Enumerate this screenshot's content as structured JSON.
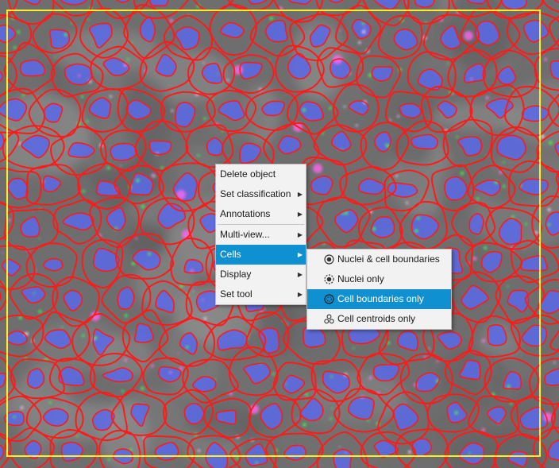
{
  "context_menu": {
    "items": [
      {
        "label": "Delete object",
        "submenu": false
      },
      {
        "label": "Set classification",
        "submenu": true
      },
      {
        "label": "Annotations",
        "submenu": true
      },
      {
        "label": "Multi-view...",
        "submenu": true
      },
      {
        "label": "Cells",
        "submenu": true,
        "active": true
      },
      {
        "label": "Display",
        "submenu": true
      },
      {
        "label": "Set tool",
        "submenu": true
      }
    ],
    "submenu_arrow": "▶"
  },
  "cells_submenu": {
    "items": [
      {
        "label": "Nuclei & cell boundaries",
        "icon": "nuclei-and-cell-boundaries-icon"
      },
      {
        "label": "Nuclei only",
        "icon": "nuclei-only-icon"
      },
      {
        "label": "Cell boundaries only",
        "icon": "cell-boundaries-only-icon",
        "active": true
      },
      {
        "label": "Cell centroids only",
        "icon": "cell-centroids-only-icon"
      }
    ]
  },
  "colors": {
    "cell_boundary": "#ff1a1a",
    "nucleus": "#5b68e8",
    "selection_box": "#ffee22",
    "menu_highlight": "#0f90d0"
  }
}
